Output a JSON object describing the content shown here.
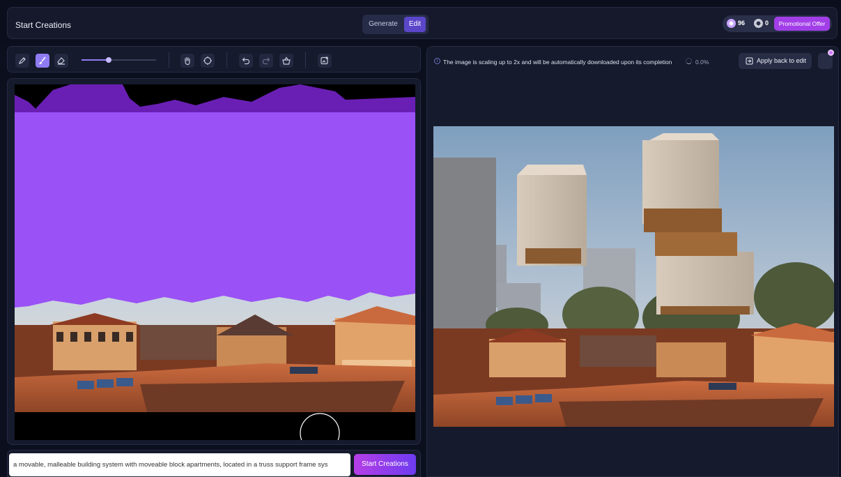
{
  "header": {
    "title": "Start Creations",
    "mode_tabs": [
      "Generate",
      "Edit"
    ],
    "active_mode": "Edit",
    "credits": [
      {
        "icon": "purple-credit-coin-icon",
        "value": "96"
      },
      {
        "icon": "gray-credit-coin-icon",
        "value": "0"
      }
    ],
    "promo_label": "Promotional Offer"
  },
  "toolbar": {
    "tools": [
      "pen-icon",
      "brush-icon",
      "eraser-icon",
      "hand-pan-icon",
      "target-icon",
      "undo-icon",
      "redo-icon",
      "clear-basket-icon",
      "add-image-icon"
    ],
    "active_tool": "brush-icon",
    "brush_size_level": 0.36
  },
  "prompt": {
    "value": "a movable, malleable building system with moveable block apartments, located in a truss support frame sys",
    "submit_label": "Start Creations"
  },
  "result": {
    "status_message": "The image is scaling up to 2x and will be automatically downloaded upon its completion",
    "progress": "0.0%",
    "apply_label": "Apply back to edit"
  },
  "colors": {
    "accent": "#8f7cf2",
    "mask": "#9a51f5",
    "promo": "#a23ee8",
    "background": "#0c0f1e"
  }
}
